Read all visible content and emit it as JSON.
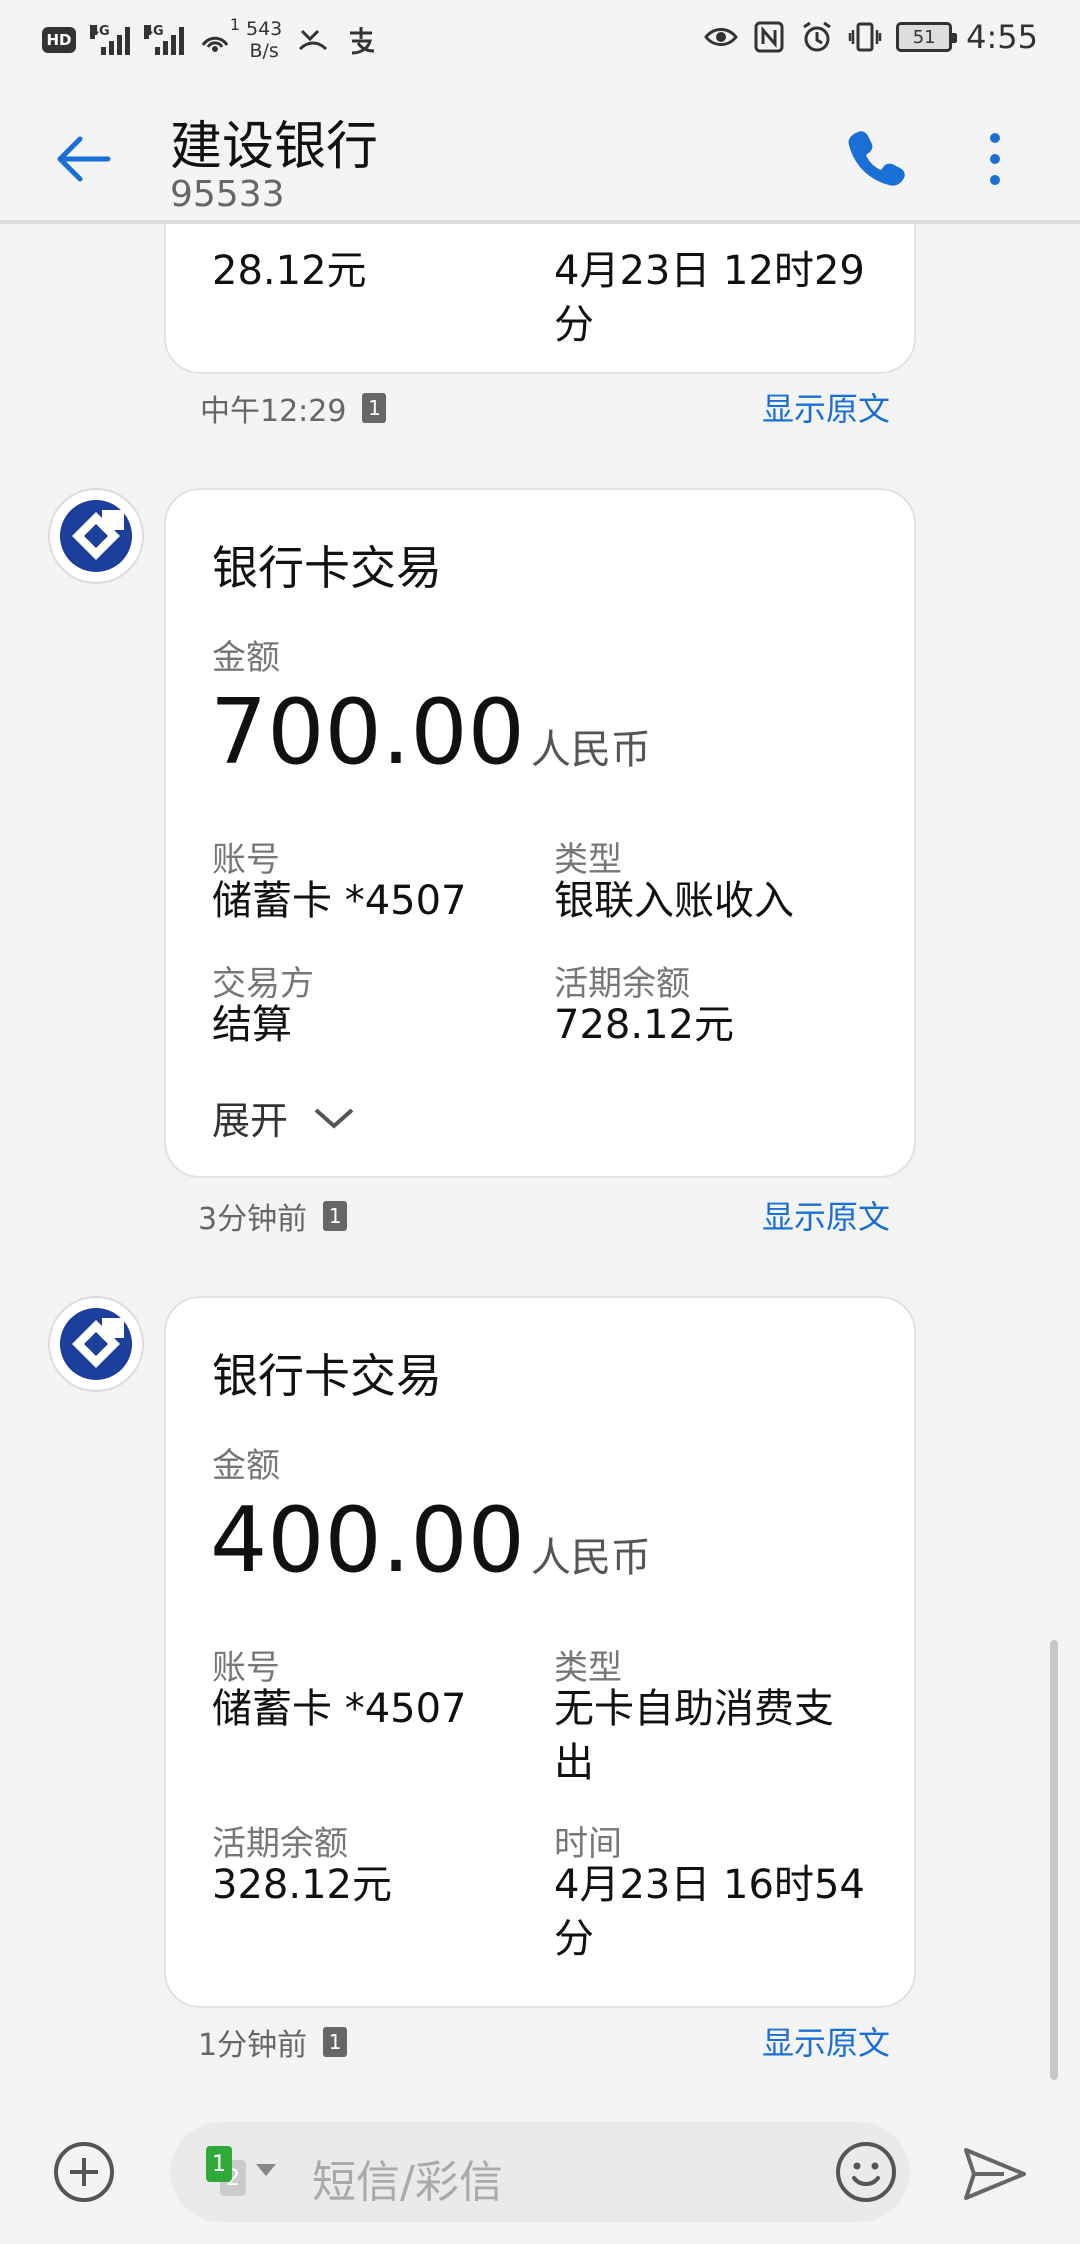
{
  "status_bar": {
    "hd": "HD",
    "net1": "4G",
    "net2": "4G",
    "wifi_badge": "1",
    "speed_value": "543",
    "speed_unit": "B/s",
    "battery": "51",
    "time": "4:55"
  },
  "header": {
    "title": "建设银行",
    "subtitle": "95533"
  },
  "partial_card": {
    "left_value": "28.12元",
    "right_value_line1": "4月23日 12时29",
    "right_value_line2": "分"
  },
  "messages": [
    {
      "meta_time": "中午12:29",
      "sim": "1",
      "show_original": "显示原文"
    },
    {
      "title": "银行卡交易",
      "amount_label": "金额",
      "amount": "700.00",
      "unit": "人民币",
      "f1_label": "账号",
      "f1_value": "储蓄卡 *4507",
      "f2_label": "类型",
      "f2_value": "银联入账收入",
      "f3_label": "交易方",
      "f3_value": "结算",
      "f4_label": "活期余额",
      "f4_value": "728.12元",
      "expand": "展开",
      "meta_time": "3分钟前",
      "sim": "1",
      "show_original": "显示原文"
    },
    {
      "title": "银行卡交易",
      "amount_label": "金额",
      "amount": "400.00",
      "unit": "人民币",
      "f1_label": "账号",
      "f1_value": "储蓄卡 *4507",
      "f2_label": "类型",
      "f2_value_line1": "无卡自助消费支",
      "f2_value_line2": "出",
      "f3_label": "活期余额",
      "f3_value": "328.12元",
      "f4_label": "时间",
      "f4_value_line1": "4月23日 16时54",
      "f4_value_line2": "分",
      "meta_time": "1分钟前",
      "sim": "1",
      "show_original": "显示原文"
    }
  ],
  "composer": {
    "sim1": "1",
    "sim2": "2",
    "placeholder": "短信/彩信"
  },
  "colors": {
    "accent": "#1a6fd6",
    "bank_blue": "#1b3f9a"
  }
}
